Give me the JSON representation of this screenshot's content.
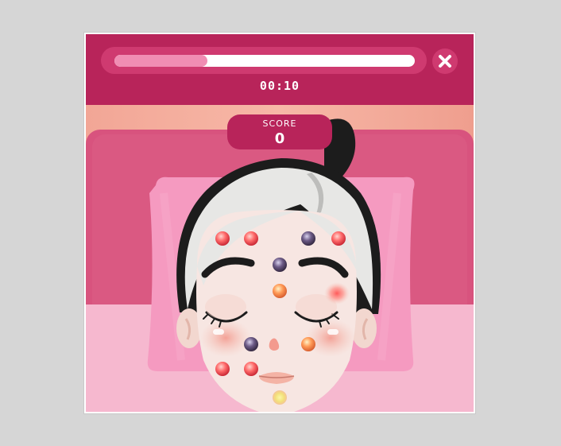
{
  "hud": {
    "timer": "00:10",
    "progress": 0.31,
    "score_label": "SCORE",
    "score_value": "0",
    "close_icon": "close-icon"
  },
  "colors": {
    "header": "#b8245a",
    "pill": "#cf3a70",
    "progress_fill": "#f08db3",
    "pillow": "#f59ac0",
    "headboard": "#d8537e"
  }
}
